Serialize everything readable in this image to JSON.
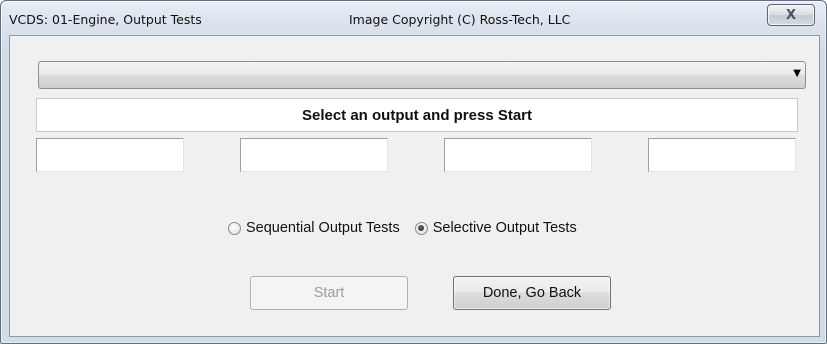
{
  "window": {
    "title": "VCDS: 01-Engine,  Output Tests",
    "copyright": "Image Copyright (C) Ross-Tech, LLC",
    "close_label": "X"
  },
  "dropdown": {
    "selected": "",
    "arrow_icon": "chevron-down-icon"
  },
  "status": {
    "message": "Select an output and press Start"
  },
  "fields": [
    "",
    "",
    "",
    ""
  ],
  "modes": {
    "sequential_label": "Sequential Output Tests",
    "selective_label": "Selective Output Tests",
    "selected": "selective"
  },
  "buttons": {
    "start_label": "Start",
    "start_enabled": false,
    "done_label": "Done, Go Back"
  }
}
